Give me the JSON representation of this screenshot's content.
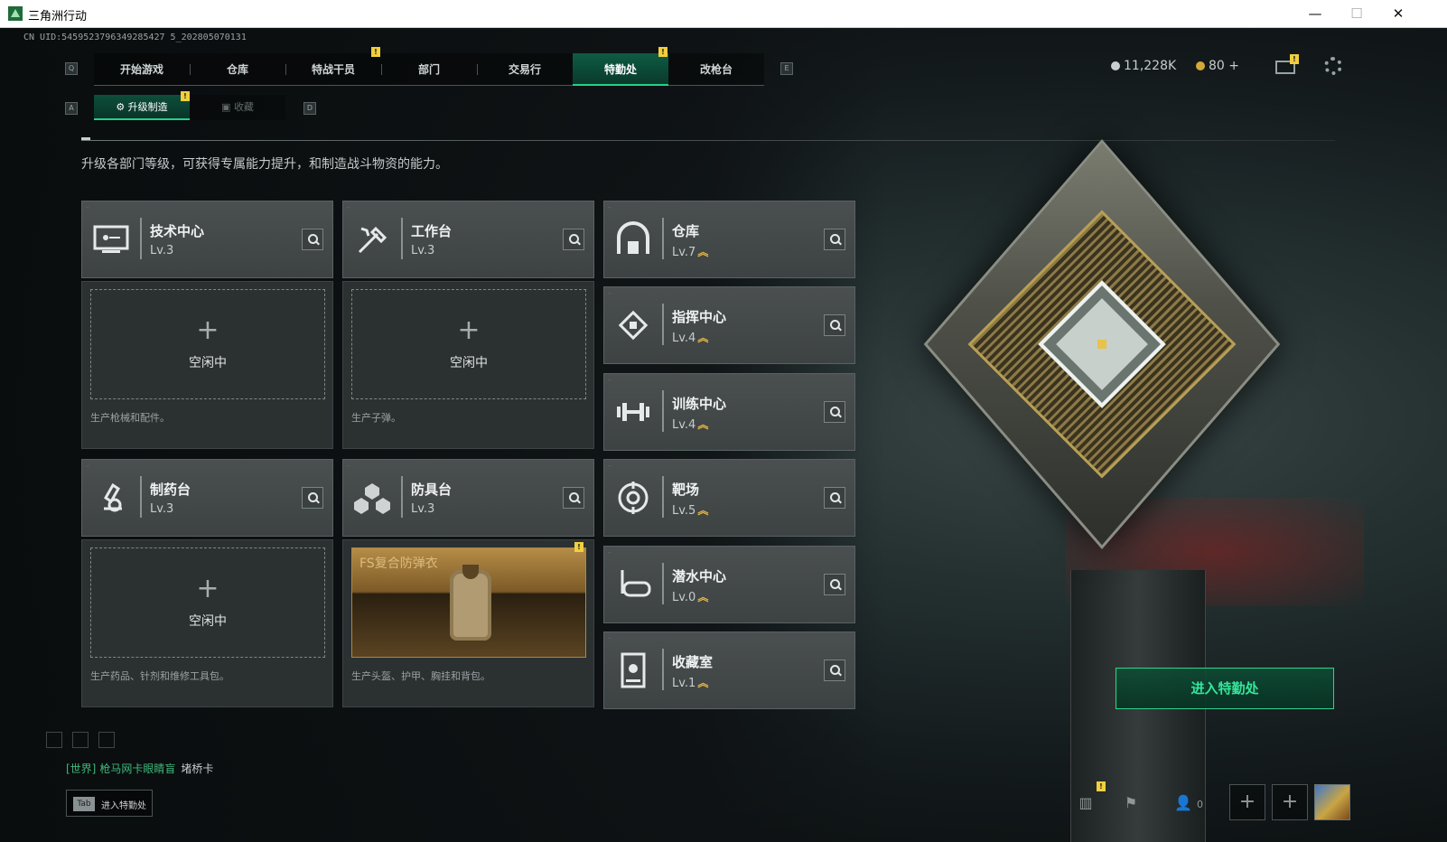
{
  "window": {
    "title": "三角洲行动",
    "minimize": "—",
    "maximize": "☐",
    "close": "✕"
  },
  "uid": "CN UID:5459523796349285427 5_202805070131",
  "nav": {
    "left_key": "Q",
    "right_key": "E",
    "tabs": [
      {
        "label": "开始游戏"
      },
      {
        "label": "仓库"
      },
      {
        "label": "特战干员",
        "alert": "!"
      },
      {
        "label": "部门"
      },
      {
        "label": "交易行"
      },
      {
        "label": "特勤处",
        "alert": "!",
        "active": true
      },
      {
        "label": "改枪台"
      }
    ]
  },
  "currency": {
    "coins": "11,228K",
    "tickets": "80",
    "tickets_add": "+"
  },
  "mail_alert": "!",
  "subtabs": {
    "left_key": "A",
    "right_key": "D",
    "items": [
      {
        "label": "升级制造",
        "active": true,
        "alert": "!"
      },
      {
        "label": "收藏"
      }
    ]
  },
  "description": "升级各部门等级，可获得专属能力提升，和制造战斗物资的能力。",
  "cards": {
    "tech_center": {
      "name": "技术中心",
      "level": "Lv.3"
    },
    "workbench": {
      "name": "工作台",
      "level": "Lv.3"
    },
    "warehouse": {
      "name": "仓库",
      "level": "Lv.7"
    },
    "command_center": {
      "name": "指挥中心",
      "level": "Lv.4"
    },
    "training_center": {
      "name": "训练中心",
      "level": "Lv.4"
    },
    "pharmacy": {
      "name": "制药台",
      "level": "Lv.3"
    },
    "armor_bench": {
      "name": "防具台",
      "level": "Lv.3"
    },
    "range": {
      "name": "靶场",
      "level": "Lv.5"
    },
    "diving_center": {
      "name": "潜水中心",
      "level": "Lv.0"
    },
    "collection_room": {
      "name": "收藏室",
      "level": "Lv.1"
    }
  },
  "slots": {
    "idle_plus": "+",
    "idle_label": "空闲中",
    "tech_desc": "生产枪械和配件。",
    "workbench_desc": "生产子弹。",
    "pharmacy_desc": "生产药品、针剂和维修工具包。",
    "armor_desc": "生产头盔、护甲、胸挂和背包。",
    "armor_item_name": "FS复合防弹衣",
    "armor_alert": "!"
  },
  "enter_button": "进入特勤处",
  "chat": {
    "channel": "[世界]",
    "name": "枪马网卡眼睛盲",
    "message": "堵桥卡"
  },
  "tab_hint": {
    "key": "Tab",
    "label": "进入特勤处"
  },
  "bottom": {
    "friends_count": "0",
    "add1": "+",
    "add2": "+",
    "alert": "!"
  },
  "colors": {
    "accent": "#23d18b",
    "alert": "#f1cf3d",
    "level_up": "#e6b843"
  }
}
